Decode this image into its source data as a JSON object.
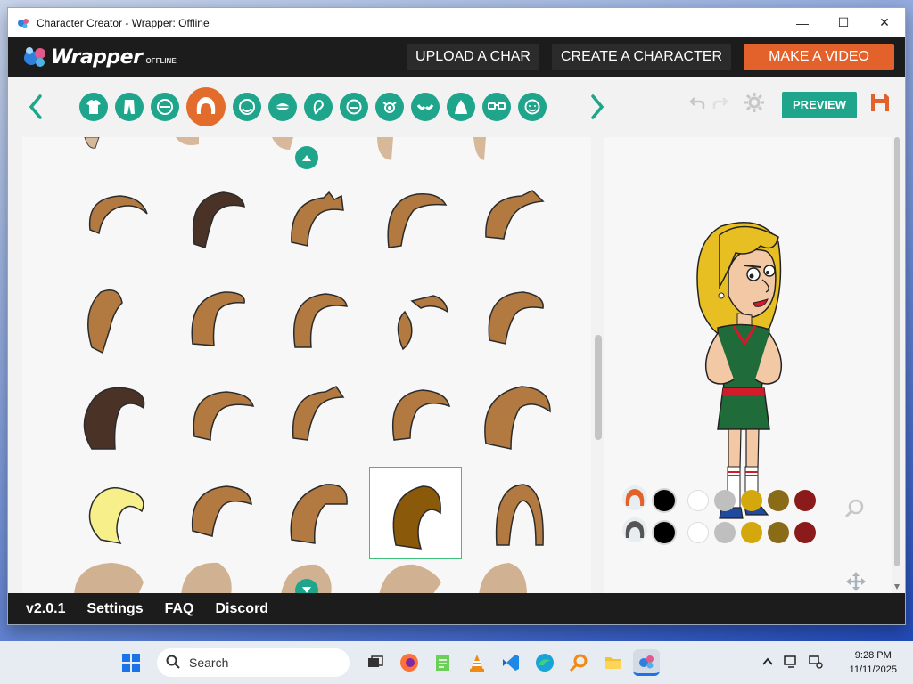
{
  "window": {
    "title": "Character Creator - Wrapper: Offline",
    "controls": [
      "minimize",
      "maximize",
      "close"
    ]
  },
  "brand": {
    "logo_word": "Wrapper",
    "logo_sub": "OFFLINE"
  },
  "nav": {
    "upload": "UPLOAD A CHAR",
    "create": "CREATE A CHARACTER",
    "make_video": "MAKE A VIDEO"
  },
  "toolbar": {
    "categories": [
      "upper-body",
      "lower-body",
      "face",
      "hair",
      "head",
      "mouth",
      "ear",
      "nose",
      "eyes",
      "eyebrows",
      "skin",
      "glasses",
      "facial-hair"
    ],
    "active_category": "hair",
    "preview_label": "PREVIEW"
  },
  "hair_grid": {
    "rows": 4,
    "columns": 5,
    "selected_index": 18
  },
  "palette": {
    "rows": [
      {
        "part": "hair",
        "colors": [
          "#000000",
          "#ffffff",
          "#bfbfbf",
          "#d4a80c",
          "#8a6b18",
          "#8b1a1a"
        ]
      },
      {
        "part": "hair-2",
        "colors": [
          "#000000",
          "#ffffff",
          "#bfbfbf",
          "#d4a80c",
          "#8a6b18",
          "#8b1a1a"
        ]
      }
    ]
  },
  "colors": {
    "accent": "#1ea58b",
    "orange": "#e3612b",
    "topbar": "#1c1c1c"
  },
  "footer": {
    "version": "v2.0.1",
    "settings": "Settings",
    "faq": "FAQ",
    "discord": "Discord"
  },
  "taskbar": {
    "search_placeholder": "Search",
    "time": "9:28 PM",
    "date": "11/11/2025"
  }
}
